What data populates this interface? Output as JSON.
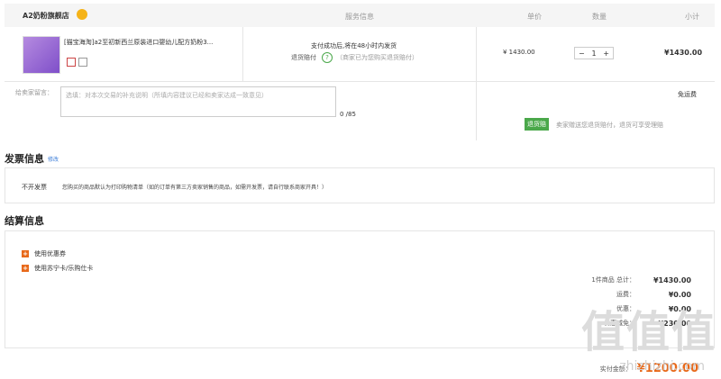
{
  "store": {
    "name": "A2奶粉旗舰店"
  },
  "headers": {
    "service": "服务信息",
    "price": "单价",
    "qty": "数量",
    "subtotal": "小计"
  },
  "product": {
    "title": "[猫宝海淘]a2至初新西兰原装进口婴幼儿配方奶粉3...",
    "service_line1": "支付成功后,将在48小时内发货",
    "return_label": "退货赔付",
    "return_note": "（商家已为您购买退货赔付）",
    "price": "¥ 1430.00",
    "qty": "1",
    "minus": "−",
    "plus": "+",
    "subtotal": "¥1430.00"
  },
  "message": {
    "label": "给卖家留言：",
    "placeholder": "选填：对本次交易的补充说明（所填内容建议已经和卖家达成一致意见）",
    "counter": "0 /85",
    "shipping": "免运费",
    "badge": "退货赔",
    "badge_note": "卖家赠送您退货赔付，退货可享受理赔"
  },
  "invoice": {
    "title": "发票信息",
    "edit": "修改",
    "type": "不开发票",
    "note": "您购买的商品默认为打印购物清单（如的订单有第三方卖家销售的商品，如需开发票，请自行联系商家开具！）"
  },
  "settle": {
    "title": "结算信息",
    "coupon": "使用优惠券",
    "card": "使用苏宁卡/乐购仕卡",
    "count_label": "1件商品 总计：",
    "total": "¥1430.00",
    "ship_label": "运费：",
    "ship": "¥0.00",
    "discount_label": "优惠：",
    "discount": "¥0.00",
    "reduce_label": "优惠减免：",
    "reduce": "-¥230.00",
    "pay_label": "实付金额：",
    "pay": "¥1200.00"
  },
  "watermark": {
    "text": "值值值",
    "url": "zhizhizhi.com"
  }
}
